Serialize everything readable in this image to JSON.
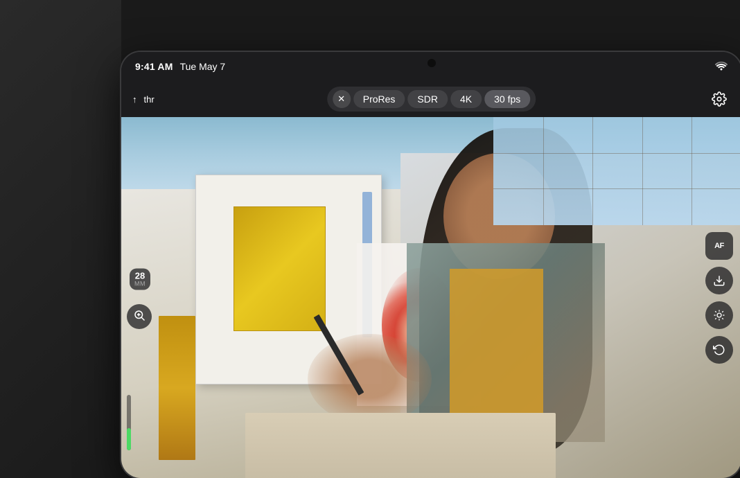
{
  "device": {
    "status_bar": {
      "time": "9:41 AM",
      "date": "Tue May 7",
      "wifi_icon": "wifi-icon"
    },
    "control_bar": {
      "close_btn": "×",
      "thr_label": "thr",
      "mode_badge": "ProRes",
      "color_badge": "SDR",
      "resolution_badge": "4K",
      "fps_badge": "30 fps",
      "settings_icon": "gear-icon"
    },
    "viewfinder": {
      "focal_length_number": "28",
      "focal_length_unit": "MM",
      "zoom_icon": "search-plus-icon",
      "right_buttons": [
        {
          "label": "AF",
          "icon": "af-icon"
        },
        {
          "label": "↓",
          "icon": "download-icon"
        },
        {
          "label": "☀",
          "icon": "exposure-icon"
        },
        {
          "label": "↺",
          "icon": "reset-icon"
        }
      ],
      "exposure_bar_fill_pct": 40
    }
  },
  "colors": {
    "background": "#1a1a1a",
    "device_bg": "#1c1c1e",
    "control_bar_bg": "rgba(28,28,30,1)",
    "pill_bg": "rgba(70,70,75,0.85)",
    "accent_green": "#4cd964",
    "white": "#ffffff"
  }
}
